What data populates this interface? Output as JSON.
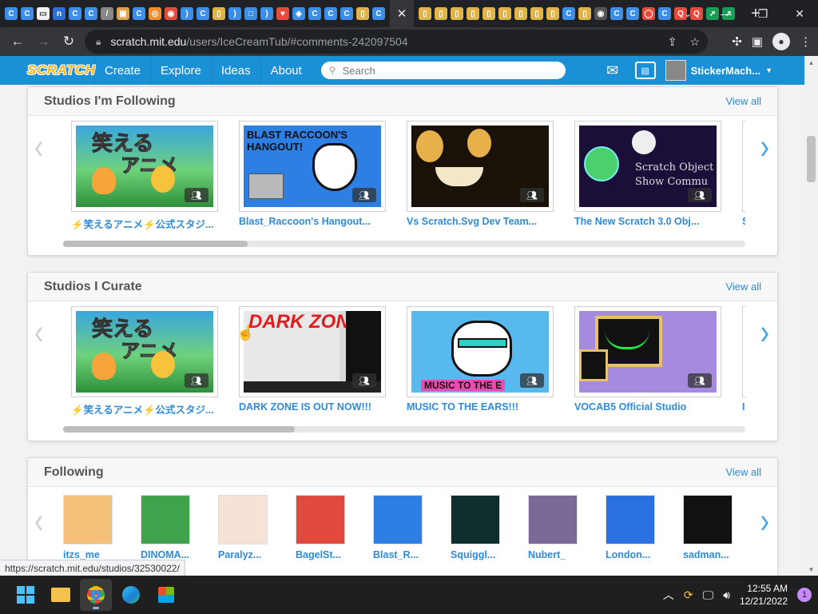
{
  "browser": {
    "tab_favicons": [
      {
        "color": "#3c8ee8",
        "glyph": "C"
      },
      {
        "color": "#3c8ee8",
        "glyph": "C"
      },
      {
        "color": "#f3f3f3",
        "glyph": "▭"
      },
      {
        "color": "#2b6ed6",
        "glyph": "n"
      },
      {
        "color": "#3c8ee8",
        "glyph": "C"
      },
      {
        "color": "#3c8ee8",
        "glyph": "C"
      },
      {
        "color": "#888888",
        "glyph": "/"
      },
      {
        "color": "#e0a14b",
        "glyph": "▣"
      },
      {
        "color": "#3c8ee8",
        "glyph": "C"
      },
      {
        "color": "#f08d2c",
        "glyph": "◎"
      },
      {
        "color": "#e64b3c",
        "glyph": "◉"
      },
      {
        "color": "#3c8ee8",
        "glyph": ")"
      },
      {
        "color": "#3c8ee8",
        "glyph": "C"
      },
      {
        "color": "#e0b447",
        "glyph": "▯"
      },
      {
        "color": "#3c8ee8",
        "glyph": ")"
      },
      {
        "color": "#3c8ee8",
        "glyph": "□"
      },
      {
        "color": "#3c8ee8",
        "glyph": ")"
      },
      {
        "color": "#e64b3c",
        "glyph": "♥"
      },
      {
        "color": "#3c8ee8",
        "glyph": "◈"
      },
      {
        "color": "#3c8ee8",
        "glyph": "C"
      },
      {
        "color": "#3c8ee8",
        "glyph": "C"
      },
      {
        "color": "#3c8ee8",
        "glyph": "C"
      },
      {
        "color": "#e0b447",
        "glyph": "▯"
      },
      {
        "color": "#3c8ee8",
        "glyph": "C"
      }
    ],
    "tab_favicons_right": [
      {
        "color": "#e0b447",
        "glyph": "▯"
      },
      {
        "color": "#e0b447",
        "glyph": "▯"
      },
      {
        "color": "#e0b447",
        "glyph": "▯"
      },
      {
        "color": "#e0b447",
        "glyph": "▯"
      },
      {
        "color": "#e0b447",
        "glyph": "▯"
      },
      {
        "color": "#e0b447",
        "glyph": "▯"
      },
      {
        "color": "#e0b447",
        "glyph": "▯"
      },
      {
        "color": "#e0b447",
        "glyph": "▯"
      },
      {
        "color": "#e0b447",
        "glyph": "▯"
      },
      {
        "color": "#3c8ee8",
        "glyph": "C"
      },
      {
        "color": "#e0b447",
        "glyph": "▯"
      },
      {
        "color": "#555555",
        "glyph": "◉"
      },
      {
        "color": "#3c8ee8",
        "glyph": "C"
      },
      {
        "color": "#3c8ee8",
        "glyph": "C"
      },
      {
        "color": "#e64b3c",
        "glyph": "◯"
      },
      {
        "color": "#3c8ee8",
        "glyph": "C"
      },
      {
        "color": "#e64b3c",
        "glyph": "Q"
      },
      {
        "color": "#e64b3c",
        "glyph": "Q"
      },
      {
        "color": "#1a9d55",
        "glyph": "➚"
      },
      {
        "color": "#1a9d55",
        "glyph": "➚"
      }
    ],
    "active_tab_close": "✕",
    "new_tab": "+",
    "window_controls": {
      "tab_search": "⌄",
      "minimize": "—",
      "maximize": "❐",
      "close": "✕"
    },
    "url_host": "scratch.mit.edu",
    "url_path": "/users/IceCreamTub/#comments-242097504",
    "status_url": "https://scratch.mit.edu/studios/32530022/"
  },
  "scratch_nav": {
    "logo": "SCRATCH",
    "links": [
      "Create",
      "Explore",
      "Ideas",
      "About"
    ],
    "search_placeholder": "Search",
    "username": "StickerMach..."
  },
  "sections": {
    "following_studios": {
      "title": "Studios I'm Following",
      "view_all": "View all",
      "studios": [
        {
          "title": "⚡笑えるアニメ⚡公式スタジ...",
          "art": "anime"
        },
        {
          "title": "Blast_Raccoon's Hangout...",
          "art": "blast",
          "art_text": "BLAST RACCOON'S HANGOUT!"
        },
        {
          "title": "Vs Scratch.Svg Dev Team...",
          "art": "vs"
        },
        {
          "title": "The New Scratch 3.0 Obj...",
          "art": "obj",
          "art_text": "Scratch Object Show Commu"
        }
      ],
      "partial_title": "S",
      "scroll_fraction": 0.27
    },
    "curate_studios": {
      "title": "Studios I Curate",
      "view_all": "View all",
      "studios": [
        {
          "title": "⚡笑えるアニメ⚡公式スタジ...",
          "art": "anime"
        },
        {
          "title": "DARK ZONE IS OUT NOW!!!",
          "art": "dark",
          "art_text": "DARK ZONE"
        },
        {
          "title": "MUSIC TO THE EARS!!!",
          "art": "music",
          "art_text": "MUSIC TO THE E"
        },
        {
          "title": "VOCAB5 Official Studio",
          "art": "vocab"
        }
      ],
      "partial_title": "I",
      "scroll_fraction": 0.34
    },
    "following": {
      "title": "Following",
      "view_all": "View all",
      "users": [
        {
          "name": "itzs_me",
          "color": "#f4c07a"
        },
        {
          "name": "DINOMA...",
          "color": "#3fa34d"
        },
        {
          "name": "Paralyz...",
          "color": "#f6e3d6"
        },
        {
          "name": "BagelSt...",
          "color": "#e04a3c"
        },
        {
          "name": "Blast_R...",
          "color": "#2d7fe3"
        },
        {
          "name": "Squiggl...",
          "color": "#0f2f2f"
        },
        {
          "name": "Nubert_",
          "color": "#7a6a9a"
        },
        {
          "name": "London...",
          "color": "#2a70e0"
        },
        {
          "name": "sadman...",
          "color": "#111111"
        }
      ]
    }
  },
  "taskbar": {
    "time": "12:55 AM",
    "date": "12/21/2022",
    "notification_count": "1"
  },
  "colors": {
    "scratch_blue": "#1a90d6",
    "link_blue": "#2e8ad8",
    "arrow_blue": "#4aa3e8"
  }
}
